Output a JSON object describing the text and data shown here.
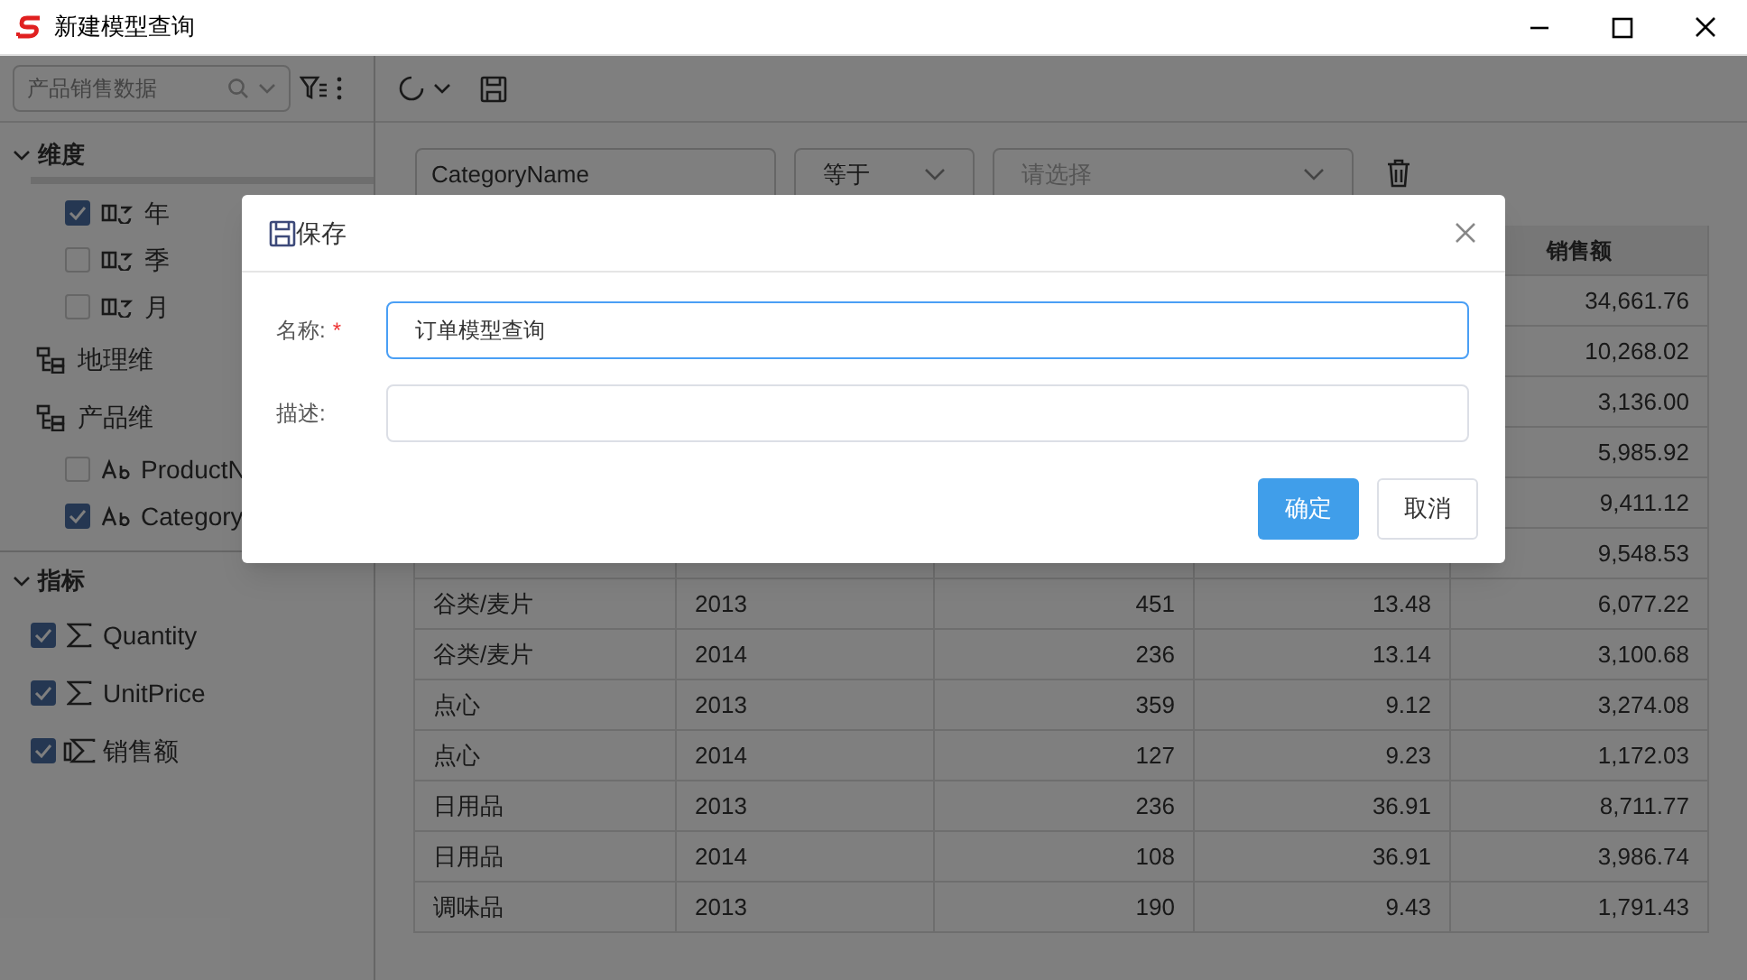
{
  "window": {
    "title": "新建模型查询"
  },
  "sidebar": {
    "source_select": {
      "value": "产品销售数据"
    },
    "sections": [
      {
        "label": "维度",
        "expanded": true,
        "items": [
          {
            "kind": "date",
            "label": "年",
            "checked": true
          },
          {
            "kind": "date",
            "label": "季",
            "checked": false
          },
          {
            "kind": "date",
            "label": "月",
            "checked": false
          },
          {
            "kind": "hierarchy",
            "label": "地理维"
          },
          {
            "kind": "hierarchy",
            "label": "产品维",
            "children": [
              {
                "kind": "text",
                "label": "ProductN",
                "checked": false
              },
              {
                "kind": "text",
                "label": "Category",
                "checked": true
              }
            ]
          }
        ]
      },
      {
        "label": "指标",
        "expanded": true,
        "items": [
          {
            "kind": "measure",
            "label": "Quantity",
            "checked": true
          },
          {
            "kind": "measure",
            "label": "UnitPrice",
            "checked": true
          },
          {
            "kind": "calculated",
            "label": "销售额",
            "checked": true
          }
        ]
      }
    ]
  },
  "filter": {
    "field": "CategoryName",
    "operator": "等于",
    "value_placeholder": "请选择"
  },
  "table": {
    "last_column_header": "销售额",
    "rows": [
      {
        "sales": "34,661.76"
      },
      {
        "sales": "10,268.02"
      },
      {
        "sales": "3,136.00"
      },
      {
        "sales": "5,985.92"
      },
      {
        "sales": "9,411.12"
      },
      {
        "sales": "9,548.53"
      },
      {
        "column_1": "谷类/麦片",
        "column_2": "2013",
        "column_3": "451",
        "column_4": "13.48",
        "sales": "6,077.22"
      },
      {
        "column_1": "谷类/麦片",
        "column_2": "2014",
        "column_3": "236",
        "column_4": "13.14",
        "sales": "3,100.68"
      },
      {
        "column_1": "点心",
        "column_2": "2013",
        "column_3": "359",
        "column_4": "9.12",
        "sales": "3,274.08"
      },
      {
        "column_1": "点心",
        "column_2": "2014",
        "column_3": "127",
        "column_4": "9.23",
        "sales": "1,172.03"
      },
      {
        "column_1": "日用品",
        "column_2": "2013",
        "column_3": "236",
        "column_4": "36.91",
        "sales": "8,711.77"
      },
      {
        "column_1": "日用品",
        "column_2": "2014",
        "column_3": "108",
        "column_4": "36.91",
        "sales": "3,986.74"
      },
      {
        "column_1": "调味品",
        "column_2": "2013",
        "column_3": "190",
        "column_4": "9.43",
        "sales": "1,791.43"
      }
    ]
  },
  "dialog": {
    "title": "保存",
    "fields": [
      {
        "label": "名称:",
        "required_mark": "*",
        "value": "订单模型查询",
        "focused": true
      },
      {
        "label": "描述:",
        "focused": false
      }
    ],
    "buttons": [
      {
        "label": "确定",
        "primary": true
      },
      {
        "label": "取消",
        "primary": false
      }
    ]
  }
}
